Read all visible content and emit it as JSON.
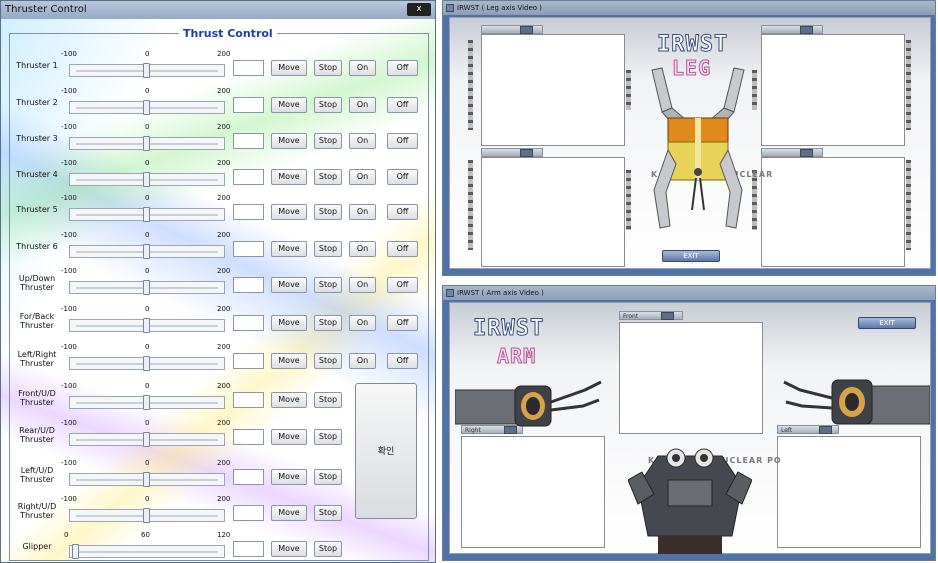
{
  "left_window": {
    "title": "Thruster Control",
    "close": "x",
    "group_title": "Thrust Control",
    "rows": [
      {
        "label": "Thruster 1",
        "min": "-100",
        "mid": "0",
        "max": "200",
        "move": "Move",
        "stop": "Stop",
        "on": "On",
        "off": "Off"
      },
      {
        "label": "Thruster 2",
        "min": "-100",
        "mid": "0",
        "max": "200",
        "move": "Move",
        "stop": "Stop",
        "on": "On",
        "off": "Off"
      },
      {
        "label": "Thruster 3",
        "min": "-100",
        "mid": "0",
        "max": "200",
        "move": "Move",
        "stop": "Stop",
        "on": "On",
        "off": "Off"
      },
      {
        "label": "Thruster 4",
        "min": "-100",
        "mid": "0",
        "max": "200",
        "move": "Move",
        "stop": "Stop",
        "on": "On",
        "off": "Off"
      },
      {
        "label": "Thruster 5",
        "min": "-100",
        "mid": "0",
        "max": "200",
        "move": "Move",
        "stop": "Stop",
        "on": "On",
        "off": "Off"
      },
      {
        "label": "Thruster 6",
        "min": "-100",
        "mid": "0",
        "max": "200",
        "move": "Move",
        "stop": "Stop",
        "on": "On",
        "off": "Off"
      },
      {
        "label_line1": "Up/Down",
        "label_line2": "Thruster",
        "min": "-100",
        "mid": "0",
        "max": "200",
        "move": "Move",
        "stop": "Stop",
        "on": "On",
        "off": "Off"
      },
      {
        "label_line1": "For/Back",
        "label_line2": "Thruster",
        "min": "-100",
        "mid": "0",
        "max": "200",
        "move": "Move",
        "stop": "Stop",
        "on": "On",
        "off": "Off"
      },
      {
        "label_line1": "Left/Right",
        "label_line2": "Thruster",
        "min": "-100",
        "mid": "0",
        "max": "200",
        "move": "Move",
        "stop": "Stop",
        "on": "On",
        "off": "Off"
      },
      {
        "label_line1": "Front/U/D",
        "label_line2": "Thruster",
        "min": "-100",
        "mid": "0",
        "max": "200",
        "move": "Move",
        "stop": "Stop"
      },
      {
        "label_line1": "Rear/U/D",
        "label_line2": "Thruster",
        "min": "-100",
        "mid": "0",
        "max": "200",
        "move": "Move",
        "stop": "Stop"
      },
      {
        "label_line1": "Left/U/D",
        "label_line2": "Thruster",
        "min": "-100",
        "mid": "0",
        "max": "200",
        "move": "Move",
        "stop": "Stop"
      },
      {
        "label_line1": "Right/U/D",
        "label_line2": "Thruster",
        "min": "-100",
        "mid": "0",
        "max": "200",
        "move": "Move",
        "stop": "Stop"
      },
      {
        "label": "Glipper",
        "min": "0",
        "mid": "60",
        "max": "120",
        "move": "Move",
        "stop": "Stop"
      }
    ],
    "confirm_label": "확인"
  },
  "leg_window": {
    "title": "IRWST ( Leg axis Video )",
    "brand_line1": "IRWST",
    "brand_line2": "LEG",
    "exit_label": "EXIT",
    "bg_text_left": "K",
    "bg_text_right": "UCLEAR"
  },
  "arm_window": {
    "title": "IRWST ( Arm axis Video )",
    "brand_line1": "IRWST",
    "brand_line2": "ARM",
    "exit_label": "EXIT",
    "front_tab": "Front",
    "right_tab": "Right",
    "left_tab": "Left",
    "bg_text_left": "K",
    "bg_text_right": "UCLEAR PO"
  },
  "colors": {
    "group_title": "#1a3ea6",
    "window_frame": "#4f72a8"
  }
}
